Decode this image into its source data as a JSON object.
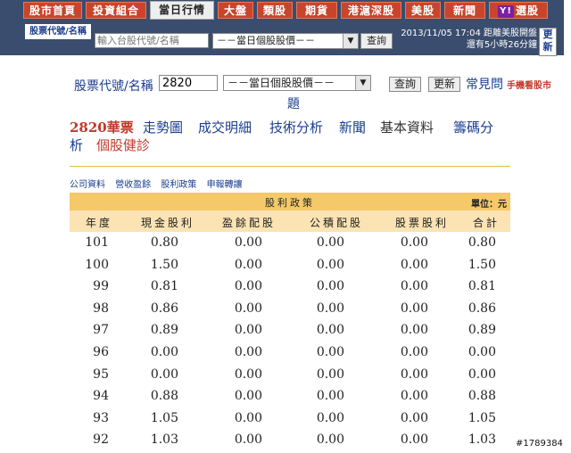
{
  "nav": {
    "tabs": [
      "股市首頁",
      "投資組合",
      "當日行情",
      "大盤",
      "類股",
      "期貨",
      "港滬深股",
      "美股",
      "新聞",
      "選股"
    ],
    "yahoo_logo": "Y!"
  },
  "topbar": {
    "label": "股票代號/名稱",
    "input_placeholder": "輸入台股代號/名稱",
    "select_value": "－－當日個股股價－－",
    "query_button": "查詢",
    "time_line1": "2013/11/05 17:04 距離美股開盤",
    "time_line2": "還有5小時26分鐘",
    "refresh_button": "更新"
  },
  "query": {
    "label": "股票代號/名稱",
    "input_value": "2820",
    "select_value": "－－當日個股股價－－",
    "query_button": "查詢",
    "update_button": "更新",
    "faq_1": "常見問",
    "faq_2": "題",
    "mobile_link": "手機看股市"
  },
  "stock": {
    "name": "2820華票",
    "tabs": [
      "走勢圖",
      "成交明細",
      "技術分析",
      "新聞",
      "基本資料",
      "籌碼分",
      "析",
      "個股健診"
    ]
  },
  "sublinks": [
    "公司資料",
    "營收盈餘",
    "股利政策",
    "申報轉讓"
  ],
  "table": {
    "title": "股利政策",
    "unit": "單位：元",
    "columns": [
      "年度",
      "現金股利",
      "盈餘配股",
      "公積配股",
      "股票股利",
      "合計"
    ],
    "rows": [
      [
        "101",
        "0.80",
        "0.00",
        "0.00",
        "0.00",
        "0.80"
      ],
      [
        "100",
        "1.50",
        "0.00",
        "0.00",
        "0.00",
        "1.50"
      ],
      [
        "99",
        "0.81",
        "0.00",
        "0.00",
        "0.00",
        "0.81"
      ],
      [
        "98",
        "0.86",
        "0.00",
        "0.00",
        "0.00",
        "0.86"
      ],
      [
        "97",
        "0.89",
        "0.00",
        "0.00",
        "0.00",
        "0.89"
      ],
      [
        "96",
        "0.00",
        "0.00",
        "0.00",
        "0.00",
        "0.00"
      ],
      [
        "95",
        "0.00",
        "0.00",
        "0.00",
        "0.00",
        "0.00"
      ],
      [
        "94",
        "0.88",
        "0.00",
        "0.00",
        "0.00",
        "0.88"
      ],
      [
        "93",
        "1.05",
        "0.00",
        "0.00",
        "0.00",
        "1.05"
      ],
      [
        "92",
        "1.03",
        "0.00",
        "0.00",
        "0.00",
        "1.03"
      ]
    ]
  },
  "watermark": "#1789384",
  "colors": {
    "nav_bg": "#3a4d6e",
    "tab_red": "#c8452c",
    "header_gold": "#f5c969",
    "link_blue": "#1a3d8f"
  }
}
